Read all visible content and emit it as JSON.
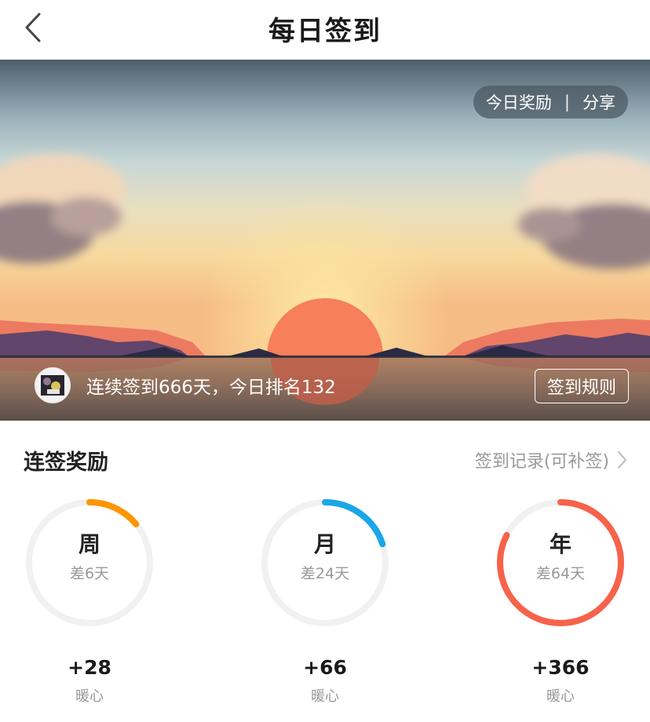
{
  "nav": {
    "title": "每日签到"
  },
  "hero": {
    "pill": {
      "reward_label": "今日奖励",
      "separator": "|",
      "share_label": "分享"
    },
    "status_text": "连续签到666天，今日排名132",
    "rules_button": "签到规则"
  },
  "section": {
    "title": "连签奖励",
    "record_link": "签到记录(可补签)"
  },
  "rings": [
    {
      "label": "周",
      "sub": "差6天",
      "reward": "+28",
      "unit": "暖心",
      "progress": 0.14,
      "color": "#ff9500"
    },
    {
      "label": "月",
      "sub": "差24天",
      "reward": "+66",
      "unit": "暖心",
      "progress": 0.2,
      "color": "#1aa6e8"
    },
    {
      "label": "年",
      "sub": "差64天",
      "reward": "+366",
      "unit": "暖心",
      "progress": 0.825,
      "color": "#f7624b"
    }
  ]
}
